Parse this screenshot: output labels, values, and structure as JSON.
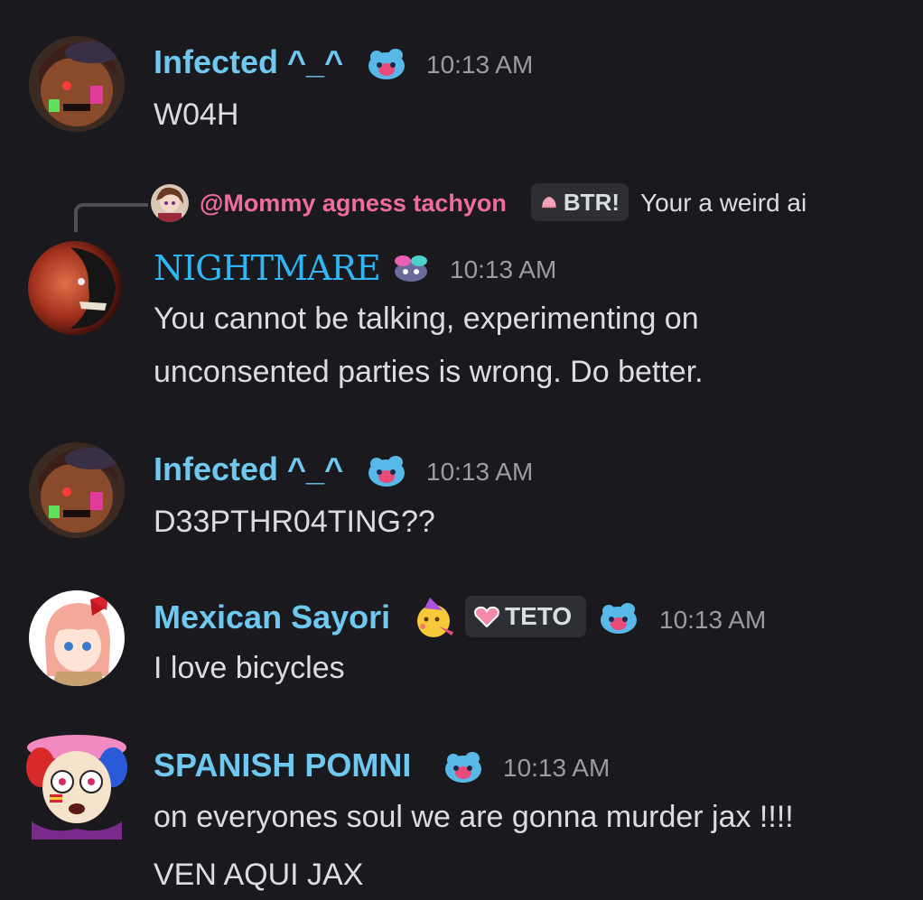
{
  "colors": {
    "background": "#1a1a1e",
    "name_blue": "#6ec8f0",
    "nightmare_blue": "#2fb6f5",
    "reply_pink": "#f06c9b",
    "timestamp": "#9a9ba3",
    "message_text": "#dbdee1"
  },
  "messages": [
    {
      "author": "Infected ^_^",
      "badge_icon": "blue-blob-emoji-icon",
      "timestamp": "10:13 AM",
      "lines": [
        "W04H"
      ]
    },
    {
      "reply": {
        "author": "@Mommy agness tachyon",
        "tag": "BTR!",
        "tag_icon": "pink-mochi-icon",
        "text": "Your a weird ai"
      },
      "author": "NIGHTMARE",
      "badge_icon": "cyan-pink-creature-emoji-icon",
      "timestamp": "10:13 AM",
      "lines": [
        "You cannot be talking, experimenting on",
        "unconsented parties is wrong. Do better."
      ]
    },
    {
      "author": "Infected ^_^",
      "badge_icon": "blue-blob-emoji-icon",
      "timestamp": "10:13 AM",
      "lines": [
        "D33PTHR04TING??"
      ]
    },
    {
      "author": "Mexican Sayori",
      "emoji_icon": "partying-face-emoji-icon",
      "tag": "TETO",
      "tag_icon": "pink-heart-icon",
      "badge_icon": "blue-blob-emoji-icon",
      "timestamp": "10:13 AM",
      "lines": [
        "I love bicycles"
      ]
    },
    {
      "author": "SPANISH POMNI",
      "badge_icon": "blue-blob-emoji-icon",
      "timestamp": "10:13 AM",
      "lines": [
        "on everyones soul we are gonna murder jax !!!!",
        "VEN AQUI JAX"
      ]
    }
  ]
}
